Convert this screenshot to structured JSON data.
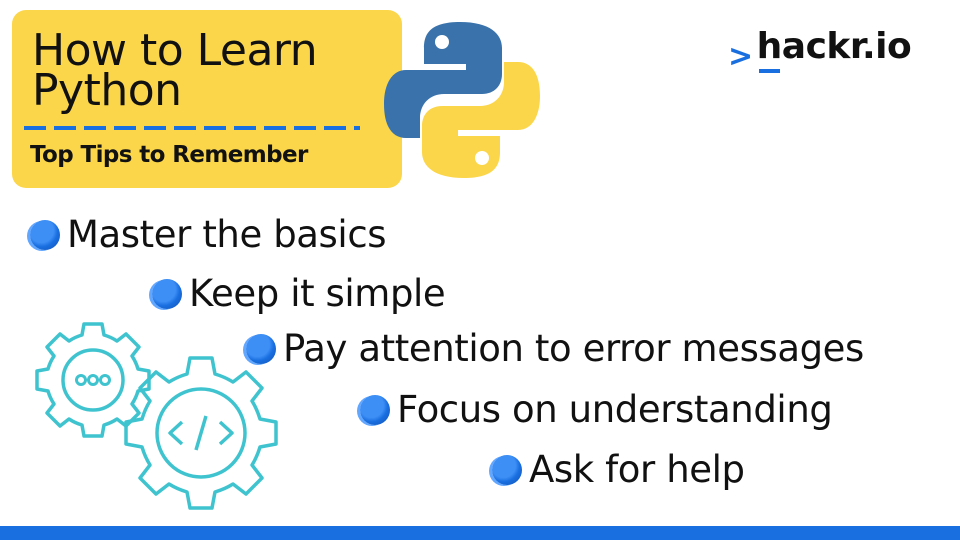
{
  "header": {
    "title_line1": "How to Learn",
    "title_line2": "Python",
    "subtitle": "Top Tips to Remember"
  },
  "brand": {
    "prefix": ">",
    "first_letter": "h",
    "rest": "ackr.io"
  },
  "tips": [
    "Master the basics",
    "Keep it simple",
    "Pay attention to error messages",
    "Focus on understanding",
    "Ask for help"
  ],
  "colors": {
    "accent_blue": "#1a6fe0",
    "title_yellow": "#fbd64a",
    "python_blue": "#3a73ab",
    "python_yellow": "#fbd64a",
    "gear_teal": "#3fc4cf"
  },
  "icons": [
    "python-logo-icon",
    "gear-dots-icon",
    "gear-code-icon",
    "bullet-dot-icon"
  ]
}
